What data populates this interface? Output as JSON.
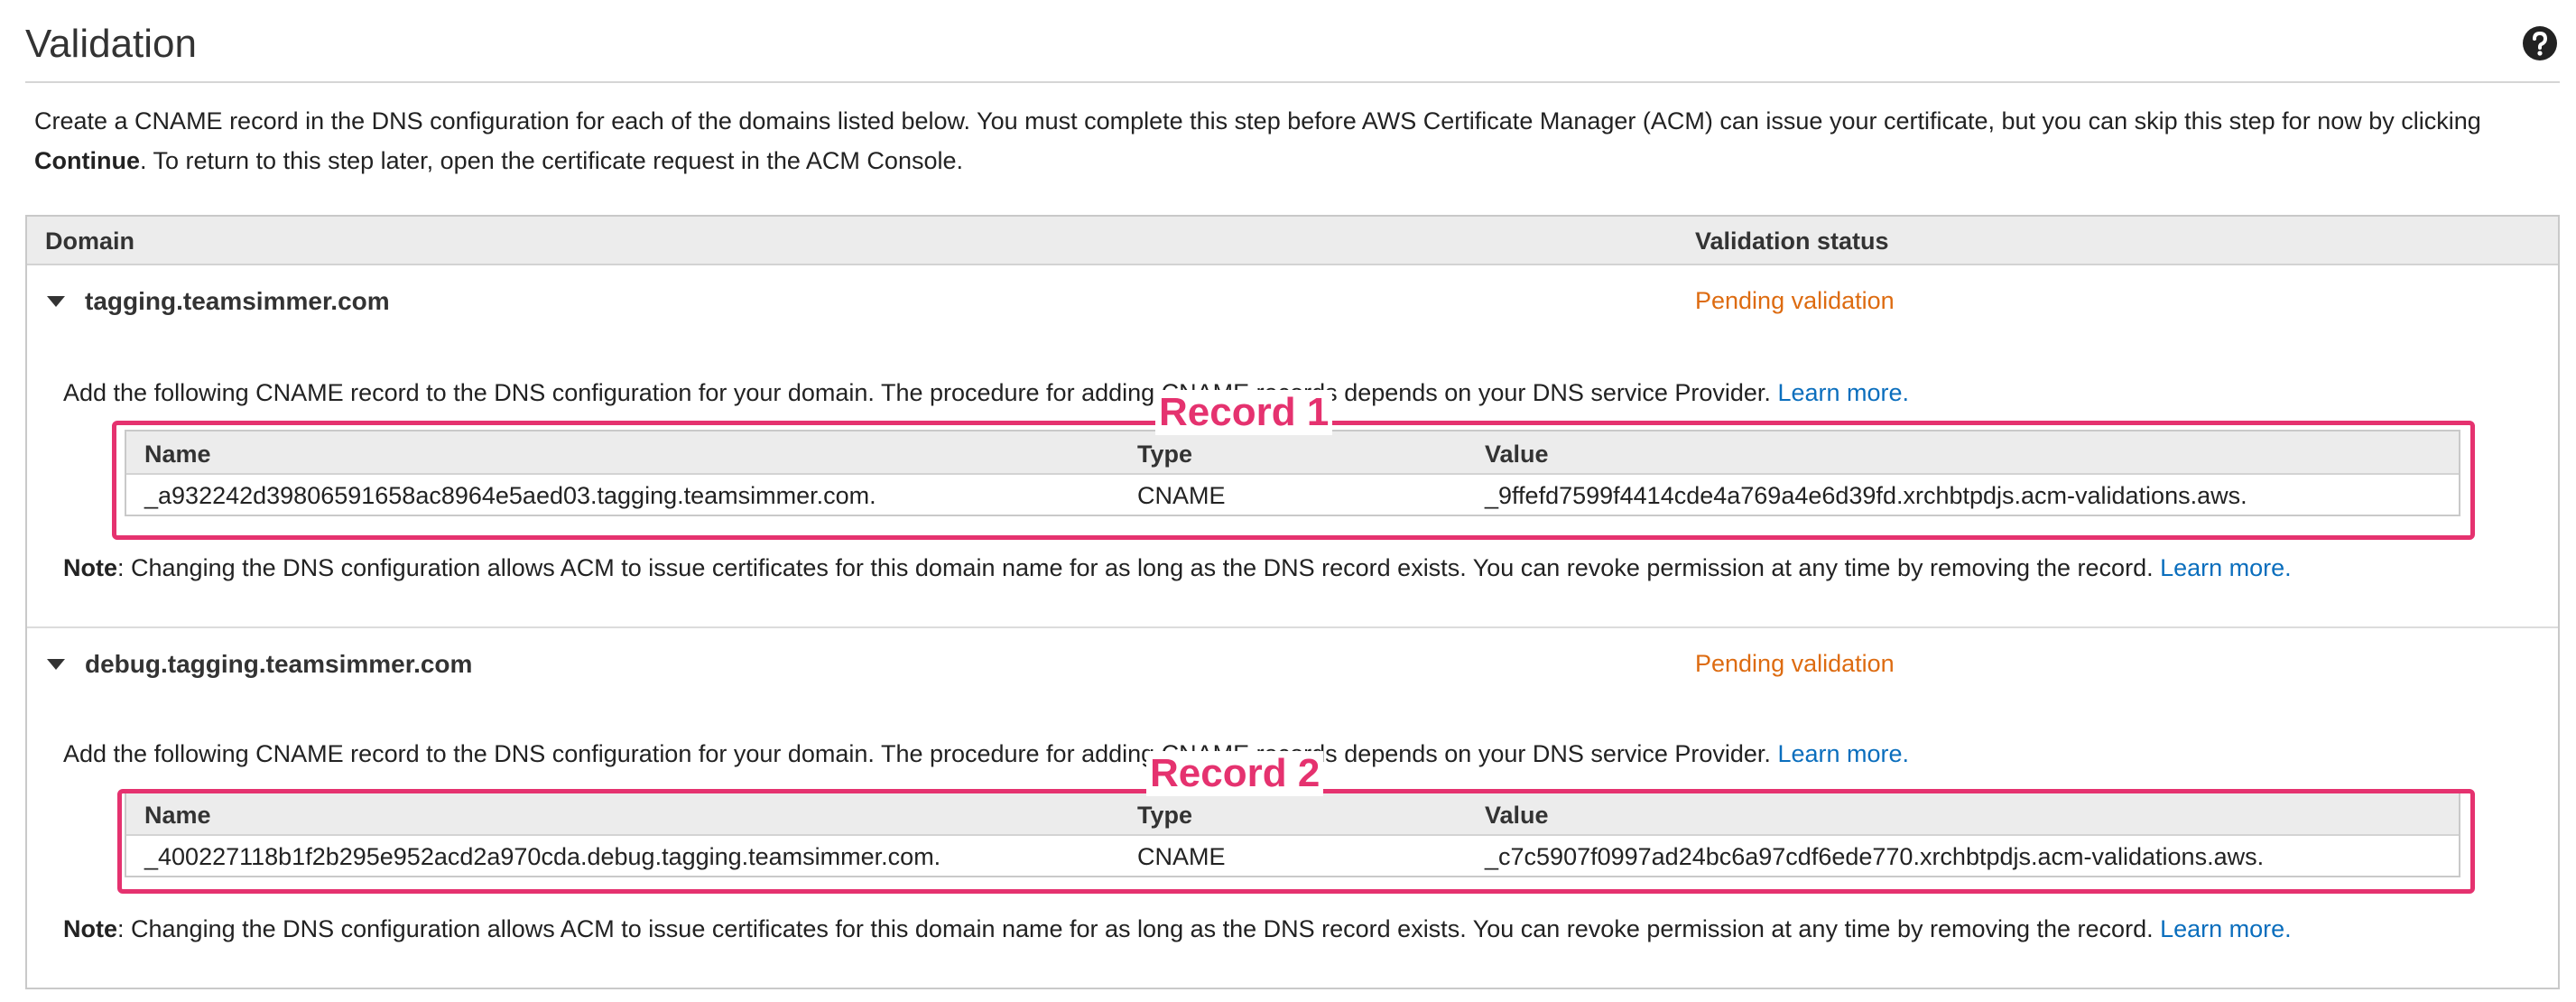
{
  "page": {
    "title": "Validation",
    "intro_part1": "Create a CNAME record in the DNS configuration for each of the domains listed below. You must complete this step before AWS Certificate Manager (ACM) can issue your certificate, but you can skip this step for now by clicking ",
    "intro_bold": "Continue",
    "intro_part2": ". To return to this step later, open the certificate request in the ACM Console."
  },
  "table": {
    "col_domain": "Domain",
    "col_status": "Validation status"
  },
  "record_columns": {
    "name": "Name",
    "type": "Type",
    "value": "Value"
  },
  "text": {
    "add_instruction": "Add the following CNAME record to the DNS configuration for your domain. The procedure for adding CNAME records depends on your DNS service Provider. ",
    "learn_more": "Learn more.",
    "note_label": "Note",
    "note_text": ": Changing the DNS configuration allows ACM to issue certificates for this domain name for as long as the DNS record exists. You can revoke permission at any time by removing the record. "
  },
  "domains": [
    {
      "name": "tagging.teamsimmer.com",
      "status": "Pending validation",
      "annotation": "Record 1",
      "record": {
        "name": "_a932242d39806591658ac8964e5aed03.tagging.teamsimmer.com.",
        "type": "CNAME",
        "value": "_9ffefd7599f4414cde4a769a4e6d39fd.xrchbtpdjs.acm-validations.aws."
      }
    },
    {
      "name": "debug.tagging.teamsimmer.com",
      "status": "Pending validation",
      "annotation": "Record 2",
      "record": {
        "name": "_400227118b1f2b295e952acd2a970cda.debug.tagging.teamsimmer.com.",
        "type": "CNAME",
        "value": "_c7c5907f0997ad24bc6a97cdf6ede770.xrchbtpdjs.acm-validations.aws."
      }
    }
  ],
  "colors": {
    "pending": "#dd6b10",
    "link": "#0a6ebd",
    "annotation": "#e5326f"
  },
  "icons": {
    "help": "question-circle-icon",
    "expand": "caret-down-icon"
  }
}
